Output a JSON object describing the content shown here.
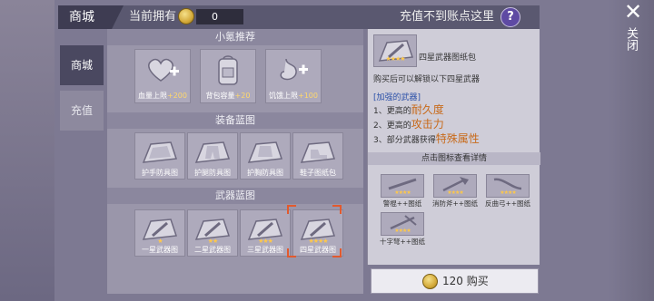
{
  "header": {
    "tab_title": "商城",
    "owned_label": "当前拥有",
    "owned_value": "0",
    "recharge_hint": "充值不到账点这里",
    "help_symbol": "?"
  },
  "side_tabs": [
    {
      "label": "商城",
      "active": true
    },
    {
      "label": "充值",
      "active": false
    }
  ],
  "sections": {
    "section1_title": "小氪推荐",
    "section2_title": "装备蓝图",
    "section3_title": "武器蓝图"
  },
  "recommend_items": [
    {
      "label": "血量上限",
      "bonus": "+200",
      "icon": "heart-plus-icon"
    },
    {
      "label": "背包容量",
      "bonus": "+20",
      "icon": "backpack-icon"
    },
    {
      "label": "饥饿上限",
      "bonus": "+100",
      "icon": "stomach-plus-icon"
    }
  ],
  "equipment_blueprints": [
    {
      "label": "护手防具图",
      "icon": "blueprint-gloves-icon"
    },
    {
      "label": "护腿防具图",
      "icon": "blueprint-leggings-icon"
    },
    {
      "label": "护胸防具图",
      "icon": "blueprint-chest-icon"
    },
    {
      "label": "鞋子图纸包",
      "icon": "blueprint-shoes-icon"
    }
  ],
  "weapon_blueprints": [
    {
      "label": "一星武器图",
      "stars": "★",
      "icon": "blueprint-weapon-1-icon"
    },
    {
      "label": "二星武器图",
      "stars": "★★",
      "icon": "blueprint-weapon-2-icon"
    },
    {
      "label": "三星武器图",
      "stars": "★★★",
      "icon": "blueprint-weapon-3-icon"
    },
    {
      "label": "四星武器图",
      "stars": "★★★★",
      "icon": "blueprint-weapon-4-icon",
      "selected": true
    }
  ],
  "detail": {
    "name": "四星武器图纸包",
    "desc": "购买后可以解锁以下四星武器",
    "enhanced_head": "[加强的武器]",
    "lines": [
      {
        "prefix": "1、更高的",
        "highlight": "耐久度"
      },
      {
        "prefix": "2、更高的",
        "highlight": "攻击力"
      },
      {
        "prefix": "3、部分武器获得",
        "highlight": "特殊属性"
      }
    ],
    "click_hint": "点击图标查看详情",
    "stars": "★★★★",
    "unlocks": [
      {
        "label": "警棍++图纸",
        "icon": "baton-blueprint-icon"
      },
      {
        "label": "消防斧++图纸",
        "icon": "fire-axe-blueprint-icon"
      },
      {
        "label": "反曲弓++图纸",
        "icon": "recurve-bow-blueprint-icon"
      },
      {
        "label": "十字弩++图纸",
        "icon": "crossbow-blueprint-icon"
      }
    ]
  },
  "buy_button": {
    "price": "120",
    "label": "购买"
  },
  "close": {
    "symbol": "✕",
    "label": "关闭"
  },
  "colors": {
    "accent_star": "#ffc84a",
    "highlight_text": "#c86a1a",
    "selection_frame": "#e25a2e",
    "help_button": "#5e4aa3"
  }
}
